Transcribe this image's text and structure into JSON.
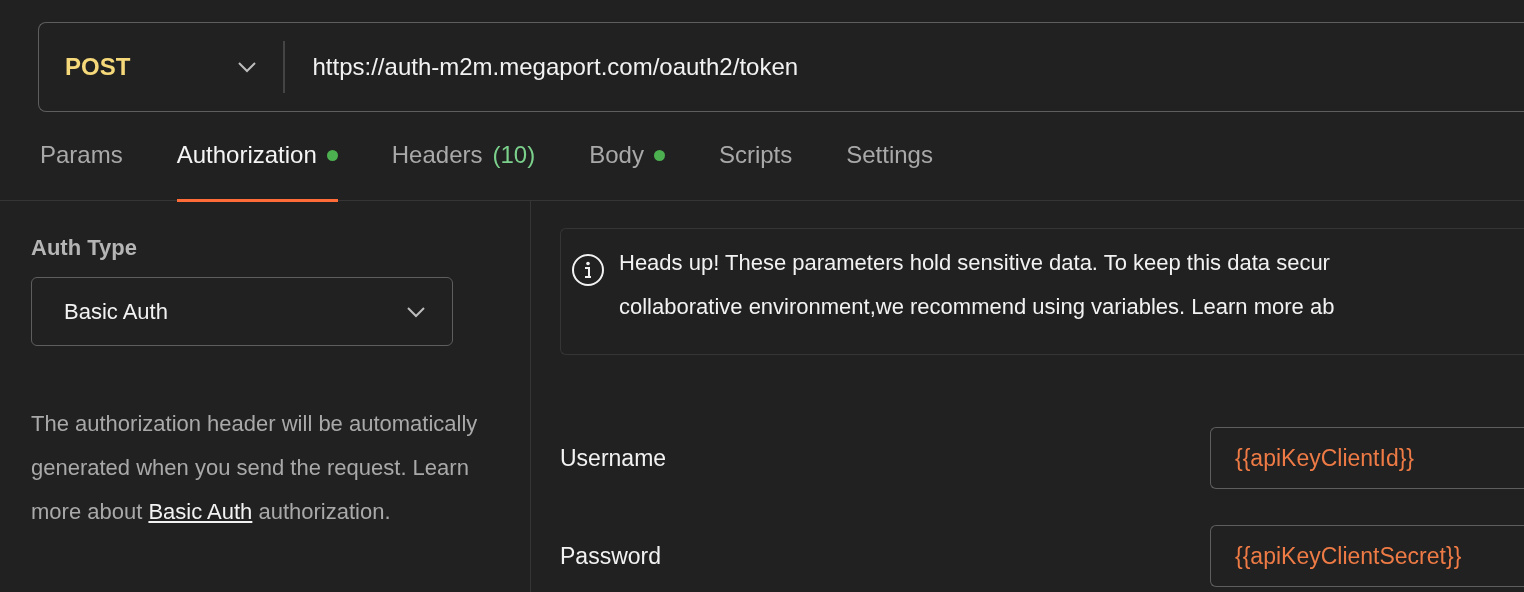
{
  "request": {
    "method": "POST",
    "url": "https://auth-m2m.megaport.com/oauth2/token"
  },
  "tabs": [
    {
      "label": "Params",
      "selected": false,
      "dot": false
    },
    {
      "label": "Authorization",
      "selected": true,
      "dot": true
    },
    {
      "label": "Headers",
      "count": "(10)",
      "selected": false,
      "dot": false
    },
    {
      "label": "Body",
      "selected": false,
      "dot": true
    },
    {
      "label": "Scripts",
      "selected": false,
      "dot": false
    },
    {
      "label": "Settings",
      "selected": false,
      "dot": false
    }
  ],
  "auth": {
    "heading": "Auth Type",
    "type": "Basic Auth",
    "description": "The authorization header will be automatically generated when you send the request. Learn more about ",
    "link": "Basic Auth",
    "description_end": " authorization."
  },
  "notice": {
    "lines": [
      "Heads up! These parameters hold sensitive data. To keep this data secur",
      "collaborative environment,we recommend using variables. Learn more ab"
    ]
  },
  "fields": [
    {
      "label": "Username",
      "value": "{{apiKeyClientId}}"
    },
    {
      "label": "Password",
      "value": "{{apiKeyClientSecret}}"
    }
  ]
}
